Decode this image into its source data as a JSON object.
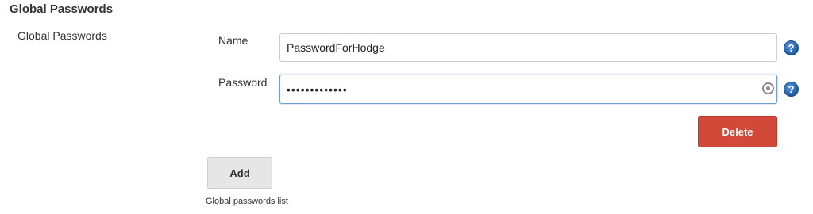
{
  "section": {
    "title": "Global Passwords"
  },
  "row": {
    "label": "Global Passwords"
  },
  "fields": {
    "name": {
      "label": "Name",
      "value": "PasswordForHodge"
    },
    "password": {
      "label": "Password",
      "value": "•••••••••••••"
    }
  },
  "buttons": {
    "delete_label": "Delete",
    "add_label": "Add"
  },
  "help": {
    "glyph": "?"
  },
  "hint": "Global passwords list",
  "icons": {
    "help": "help-icon",
    "reveal": "eye-icon"
  },
  "colors": {
    "delete": "#d24939",
    "add": "#e6e6e6",
    "help": "#1f5aa8",
    "focus_border": "#6f9ad6"
  }
}
